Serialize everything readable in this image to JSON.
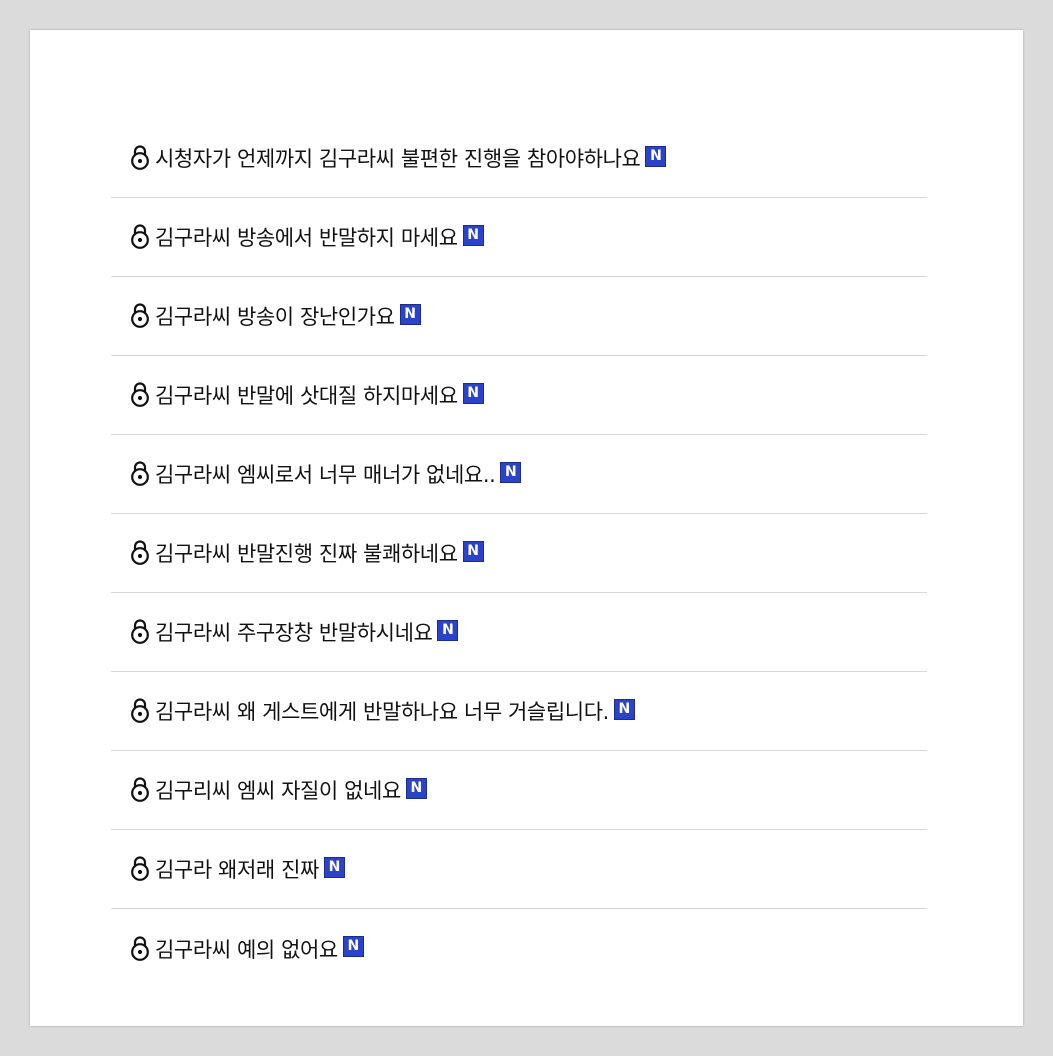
{
  "posts": [
    {
      "title": "시청자가 언제까지 김구라씨 불편한 진행을 참아야하나요",
      "badge": "N",
      "icon": "lock-icon"
    },
    {
      "title": "김구라씨 방송에서 반말하지 마세요",
      "badge": "N",
      "icon": "lock-icon"
    },
    {
      "title": "김구라씨 방송이 장난인가요",
      "badge": "N",
      "icon": "lock-icon"
    },
    {
      "title": "김구라씨 반말에 삿대질 하지마세요",
      "badge": "N",
      "icon": "lock-icon"
    },
    {
      "title": "김구라씨 엠씨로서 너무 매너가 없네요..",
      "badge": "N",
      "icon": "lock-icon"
    },
    {
      "title": "김구라씨 반말진행 진짜 불쾌하네요",
      "badge": "N",
      "icon": "lock-icon"
    },
    {
      "title": "김구라씨 주구장창 반말하시네요",
      "badge": "N",
      "icon": "lock-icon"
    },
    {
      "title": "김구라씨 왜 게스트에게 반말하나요 너무 거슬립니다.",
      "badge": "N",
      "icon": "lock-icon"
    },
    {
      "title": "김구리씨 엠씨 자질이 없네요",
      "badge": "N",
      "icon": "lock-icon"
    },
    {
      "title": "김구라 왜저래 진짜",
      "badge": "N",
      "icon": "lock-icon"
    },
    {
      "title": "김구라씨 예의 없어요",
      "badge": "N",
      "icon": "lock-icon"
    }
  ],
  "colors": {
    "background": "#dcdbdc",
    "card": "#ffffff",
    "badge": "#2a43c9",
    "divider": "#d6d6d6"
  }
}
